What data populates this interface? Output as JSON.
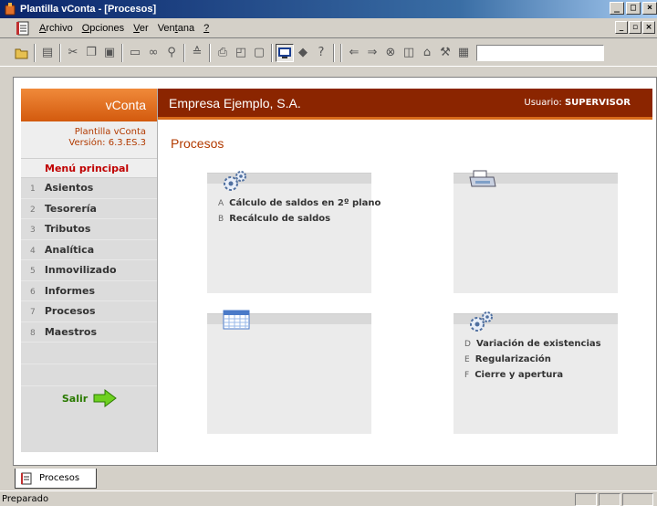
{
  "window": {
    "title": "Plantilla vConta - [Procesos]"
  },
  "menu": [
    {
      "pre": "",
      "key": "A",
      "post": "rchivo"
    },
    {
      "pre": "",
      "key": "O",
      "post": "pciones"
    },
    {
      "pre": "",
      "key": "V",
      "post": "er"
    },
    {
      "pre": "Ven",
      "key": "t",
      "post": "ana"
    },
    {
      "pre": "",
      "key": "?",
      "post": ""
    }
  ],
  "sidebar": {
    "brand": "vConta",
    "app_name": "Plantilla vConta",
    "version": "Versión: 6.3.ES.3",
    "main_menu": "Menú principal",
    "items": [
      {
        "num": "1",
        "label": "Asientos"
      },
      {
        "num": "2",
        "label": "Tesorería"
      },
      {
        "num": "3",
        "label": "Tributos"
      },
      {
        "num": "4",
        "label": "Analítica"
      },
      {
        "num": "5",
        "label": "Inmovilizado"
      },
      {
        "num": "6",
        "label": "Informes"
      },
      {
        "num": "7",
        "label": "Procesos"
      },
      {
        "num": "8",
        "label": "Maestros"
      }
    ],
    "exit_label": "Salir"
  },
  "header": {
    "company": "Empresa Ejemplo, S.A.",
    "user_label": "Usuario:",
    "user_name": "SUPERVISOR"
  },
  "section_title": "Procesos",
  "panels": {
    "top_left": [
      {
        "letter": "A",
        "label": "Cálculo de saldos en 2º plano"
      },
      {
        "letter": "B",
        "label": "Recálculo de saldos"
      }
    ],
    "bottom_right": [
      {
        "letter": "D",
        "label": "Variación de existencias"
      },
      {
        "letter": "E",
        "label": "Regularización"
      },
      {
        "letter": "F",
        "label": "Cierre y apertura"
      }
    ]
  },
  "tab": {
    "label": "Procesos"
  },
  "status": {
    "text": "Preparado"
  },
  "colors": {
    "accent": "#8b2500",
    "orange": "#d35a0e",
    "exit_green": "#2a7a00"
  }
}
